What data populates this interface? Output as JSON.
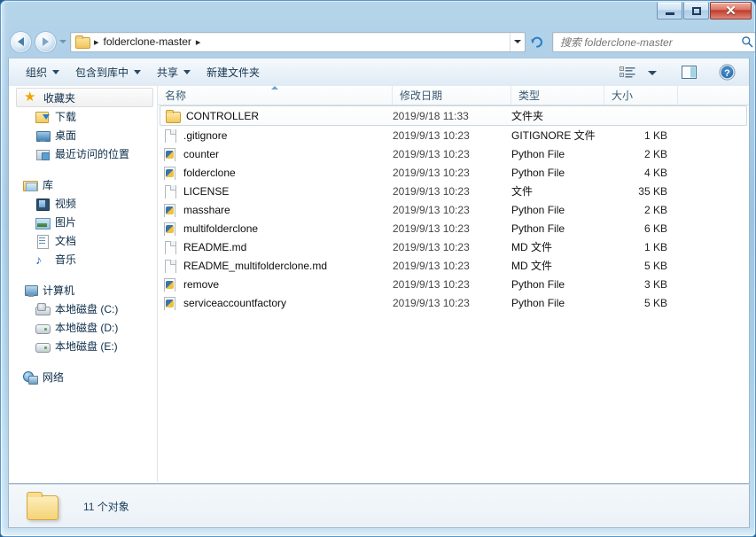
{
  "window": {
    "minimize_label": "最小化",
    "maximize_label": "最大化",
    "close_label": "关闭",
    "close_glyph": "✕"
  },
  "addressbar": {
    "back_label": "后退",
    "forward_label": "前进",
    "history_label": "最近浏览的位置",
    "path_name": "folderclone-master",
    "separator": "▸",
    "dropdown_label": "展开",
    "refresh_label": "刷新"
  },
  "search": {
    "placeholder": "搜索 folderclone-master",
    "value": "",
    "icon": "search-icon"
  },
  "toolbar": {
    "items": [
      {
        "label": "组织",
        "has_caret": true
      },
      {
        "label": "包含到库中",
        "has_caret": true
      },
      {
        "label": "共享",
        "has_caret": true
      },
      {
        "label": "新建文件夹",
        "has_caret": false
      }
    ],
    "view_label": "更改您的视图",
    "view_caret_label": "视图选项",
    "preview_label": "显示预览窗格",
    "help_label": "获取帮助",
    "help_glyph": "?"
  },
  "sidebar": {
    "groups": [
      {
        "root": {
          "label": "收藏夹",
          "icon": "star-icon",
          "selected": true
        },
        "items": [
          {
            "label": "下载",
            "icon": "download-icon"
          },
          {
            "label": "桌面",
            "icon": "desktop-icon"
          },
          {
            "label": "最近访问的位置",
            "icon": "recent-places-icon"
          }
        ]
      },
      {
        "root": {
          "label": "库",
          "icon": "library-icon",
          "selected": false
        },
        "items": [
          {
            "label": "视频",
            "icon": "video-icon"
          },
          {
            "label": "图片",
            "icon": "picture-icon"
          },
          {
            "label": "文档",
            "icon": "document-icon"
          },
          {
            "label": "音乐",
            "icon": "music-icon"
          }
        ]
      },
      {
        "root": {
          "label": "计算机",
          "icon": "computer-icon",
          "selected": false
        },
        "items": [
          {
            "label": "本地磁盘 (C:)",
            "icon": "system-drive-icon"
          },
          {
            "label": "本地磁盘 (D:)",
            "icon": "drive-icon"
          },
          {
            "label": "本地磁盘 (E:)",
            "icon": "drive-icon"
          }
        ]
      },
      {
        "root": {
          "label": "网络",
          "icon": "network-icon",
          "selected": false
        },
        "items": []
      }
    ]
  },
  "filelist": {
    "columns": [
      {
        "label": "名称",
        "sorted": true
      },
      {
        "label": "修改日期",
        "sorted": false
      },
      {
        "label": "类型",
        "sorted": false
      },
      {
        "label": "大小",
        "sorted": false
      }
    ],
    "rows": [
      {
        "name": "CONTROLLER",
        "date": "2019/9/18 11:33",
        "type": "文件夹",
        "size": "",
        "icon": "folder-icon",
        "active": true
      },
      {
        "name": ".gitignore",
        "date": "2019/9/13 10:23",
        "type": "GITIGNORE 文件",
        "size": "1 KB",
        "icon": "file-icon",
        "active": false
      },
      {
        "name": "counter",
        "date": "2019/9/13 10:23",
        "type": "Python File",
        "size": "2 KB",
        "icon": "python-file-icon",
        "active": false
      },
      {
        "name": "folderclone",
        "date": "2019/9/13 10:23",
        "type": "Python File",
        "size": "4 KB",
        "icon": "python-file-icon",
        "active": false
      },
      {
        "name": "LICENSE",
        "date": "2019/9/13 10:23",
        "type": "文件",
        "size": "35 KB",
        "icon": "file-icon",
        "active": false
      },
      {
        "name": "masshare",
        "date": "2019/9/13 10:23",
        "type": "Python File",
        "size": "2 KB",
        "icon": "python-file-icon",
        "active": false
      },
      {
        "name": "multifolderclone",
        "date": "2019/9/13 10:23",
        "type": "Python File",
        "size": "6 KB",
        "icon": "python-file-icon",
        "active": false
      },
      {
        "name": "README.md",
        "date": "2019/9/13 10:23",
        "type": "MD 文件",
        "size": "1 KB",
        "icon": "file-icon",
        "active": false
      },
      {
        "name": "README_multifolderclone.md",
        "date": "2019/9/13 10:23",
        "type": "MD 文件",
        "size": "5 KB",
        "icon": "file-icon",
        "active": false
      },
      {
        "name": "remove",
        "date": "2019/9/13 10:23",
        "type": "Python File",
        "size": "3 KB",
        "icon": "python-file-icon",
        "active": false
      },
      {
        "name": "serviceaccountfactory",
        "date": "2019/9/13 10:23",
        "type": "Python File",
        "size": "5 KB",
        "icon": "python-file-icon",
        "active": false
      }
    ]
  },
  "statusbar": {
    "text": "11 个对象",
    "icon": "folder-icon"
  },
  "colors": {
    "frame": "#9cc4e2",
    "accent": "#2573b8",
    "folder": "#f2c757",
    "close_button": "#c13d2c",
    "text": "#0d0d0d"
  }
}
